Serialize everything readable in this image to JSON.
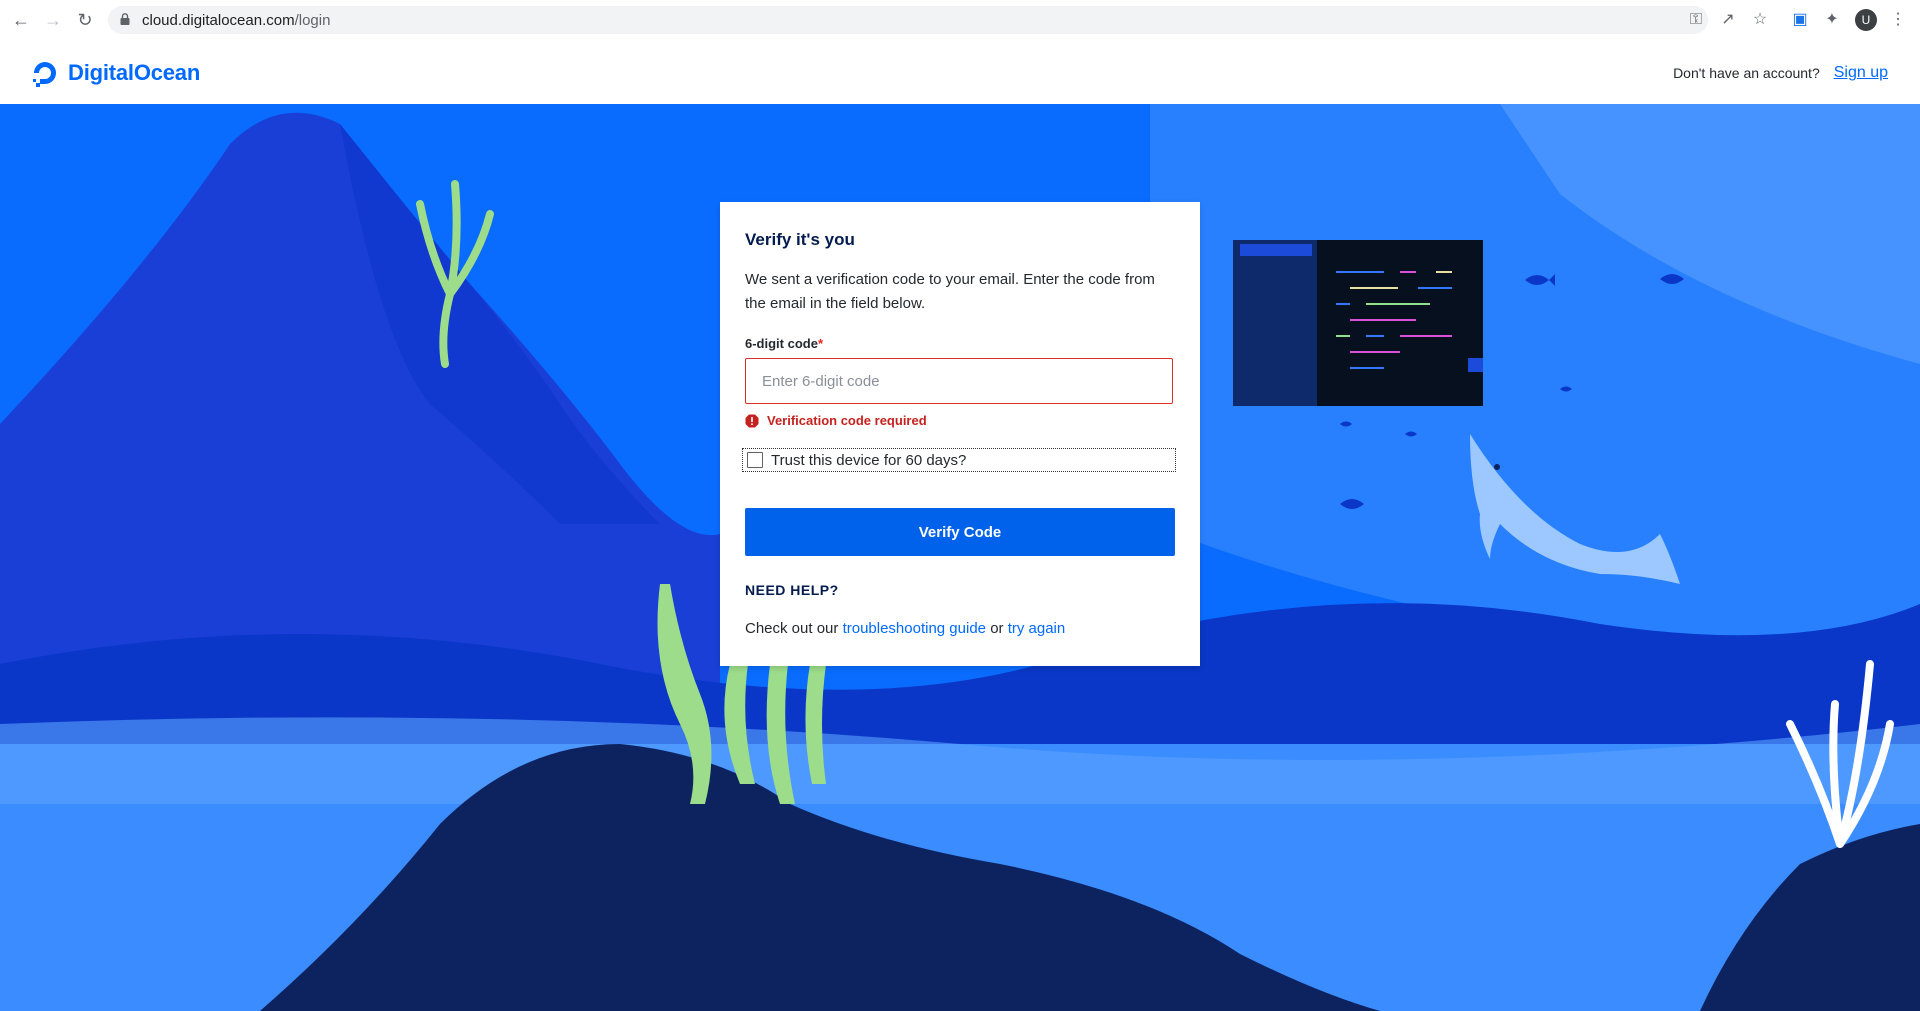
{
  "browser": {
    "url_domain": "cloud.digitalocean.com",
    "url_path": "/login",
    "profile_initial": "U"
  },
  "header": {
    "logo_text": "DigitalOcean",
    "account_prompt": "Don't have an account?",
    "signup_label": "Sign up"
  },
  "card": {
    "title": "Verify it's you",
    "description": "We sent a verification code to your email. Enter the code from the email in the field below.",
    "code_label": "6-digit code",
    "required_marker": "*",
    "code_placeholder": "Enter 6-digit code",
    "code_value": "",
    "error_message": "Verification code required",
    "trust_label": "Trust this device for 60 days?",
    "trust_checked": false,
    "verify_button": "Verify Code",
    "help_heading": "NEED HELP?",
    "help_prefix": "Check out our",
    "help_link1": "troubleshooting guide",
    "help_middle": "or",
    "help_link2": "try again"
  },
  "colors": {
    "brand": "#0069ff",
    "error": "#d93025",
    "button": "#0061eb"
  }
}
